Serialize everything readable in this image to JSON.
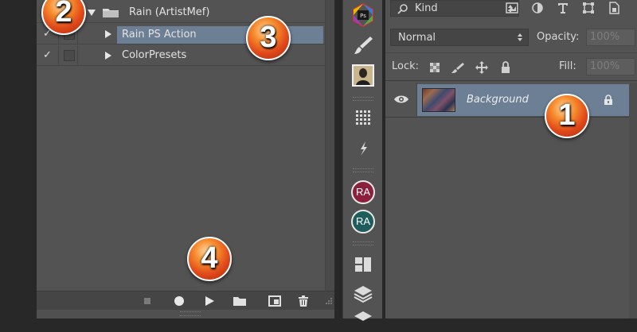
{
  "actions": {
    "rows": [
      {
        "label": "Rain (ArtistMef)",
        "checked": true,
        "is_set": true
      },
      {
        "label": "Rain PS Action",
        "checked": true,
        "selected": true
      },
      {
        "label": "ColorPresets",
        "checked": true
      }
    ],
    "check_mark": "✓",
    "footer_buttons": [
      "stop-icon",
      "record-icon",
      "play-icon",
      "new-set-icon",
      "new-action-icon",
      "trash-icon"
    ]
  },
  "toolbar": {
    "items": [
      "ps-cc-icon",
      "brush-icon",
      "person-icon",
      "grid-icon",
      "lightning-icon",
      "ra-badge-red",
      "ra-badge-teal",
      "panels-icon",
      "layers-stack-icon"
    ],
    "ra_label": "RA",
    "ps_label": "Ps",
    "ra_red_color": "#8c1f3b",
    "ra_teal_color": "#1f5c5c"
  },
  "layers": {
    "kind_label": "Kind",
    "blend_mode": "Normal",
    "opacity_label": "Opacity:",
    "opacity_value": "100%",
    "lock_label": "Lock:",
    "fill_label": "Fill:",
    "fill_value": "100%",
    "layer_name": "Background",
    "filter_icons": [
      "image-filter-icon",
      "adjustment-filter-icon",
      "type-filter-icon",
      "shape-filter-icon",
      "smart-object-filter-icon"
    ],
    "lock_icons": [
      "lock-transparent-icon",
      "lock-image-icon",
      "lock-position-icon",
      "lock-all-icon"
    ],
    "highlight_color": "#6d7f94"
  },
  "callouts": [
    "1",
    "2",
    "3",
    "4"
  ]
}
